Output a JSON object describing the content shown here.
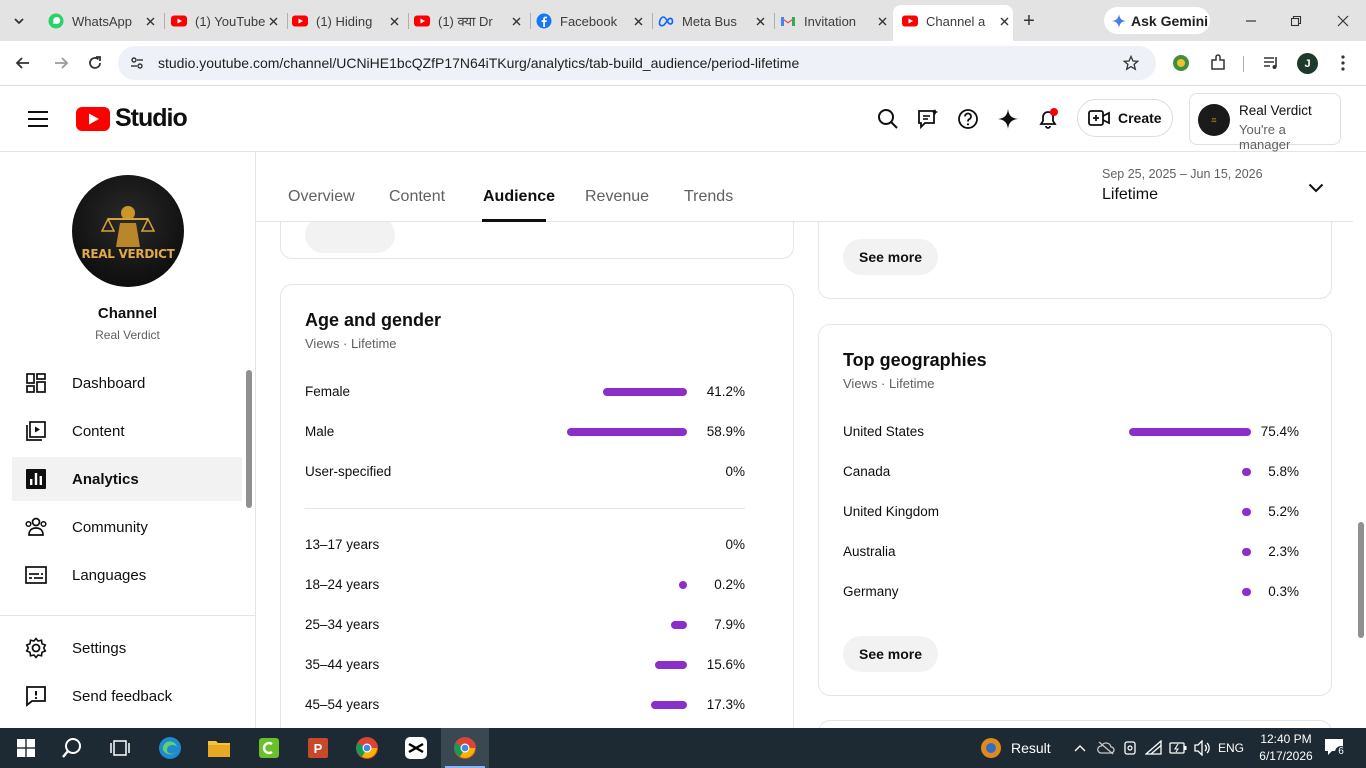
{
  "browser": {
    "tabs": [
      {
        "title": "WhatsApp",
        "favicon": "whatsapp-icon"
      },
      {
        "title": "(1) YouTube",
        "favicon": "youtube-icon"
      },
      {
        "title": "(1) Hiding",
        "favicon": "youtube-icon"
      },
      {
        "title": "(1) क्या Dr",
        "favicon": "youtube-icon"
      },
      {
        "title": "Facebook",
        "favicon": "facebook-icon"
      },
      {
        "title": "Meta Bus",
        "favicon": "meta-icon"
      },
      {
        "title": "Invitation",
        "favicon": "gmail-icon"
      },
      {
        "title": "Channel a",
        "favicon": "youtube-icon",
        "active": true
      }
    ],
    "ask_gemini": "Ask Gemini",
    "url": "studio.youtube.com/channel/UCNiHE1bcQZfP17N64iTKurg/analytics/tab-build_audience/period-lifetime",
    "profile_initial": "J"
  },
  "studio": {
    "logo_text": "Studio",
    "create_label": "Create",
    "account_name": "Real Verdict",
    "account_role": "You're a manager"
  },
  "sidebar": {
    "channel_label": "Channel",
    "channel_name": "Real Verdict",
    "avatar_text": "REAL VERDICT",
    "items": [
      {
        "label": "Dashboard",
        "icon": "dashboard-icon"
      },
      {
        "label": "Content",
        "icon": "content-icon"
      },
      {
        "label": "Analytics",
        "icon": "analytics-icon",
        "active": true
      },
      {
        "label": "Community",
        "icon": "community-icon"
      },
      {
        "label": "Languages",
        "icon": "languages-icon"
      }
    ],
    "settings": "Settings",
    "feedback": "Send feedback"
  },
  "analytics": {
    "tabs": [
      "Overview",
      "Content",
      "Audience",
      "Revenue",
      "Trends"
    ],
    "active_tab": "Audience",
    "date_range": "Sep 25, 2025 – Jun 15, 2026",
    "period": "Lifetime"
  },
  "age_gender": {
    "title": "Age and gender",
    "subtitle": "Views · Lifetime",
    "gender": [
      {
        "label": "Female",
        "value": "41.2%",
        "pct": 41.2
      },
      {
        "label": "Male",
        "value": "58.9%",
        "pct": 58.9
      },
      {
        "label": "User-specified",
        "value": "0%",
        "pct": 0
      }
    ],
    "ages": [
      {
        "label": "13–17 years",
        "value": "0%",
        "pct": 0
      },
      {
        "label": "18–24 years",
        "value": "0.2%",
        "pct": 0.2
      },
      {
        "label": "25–34 years",
        "value": "7.9%",
        "pct": 7.9
      },
      {
        "label": "35–44 years",
        "value": "15.6%",
        "pct": 15.6
      },
      {
        "label": "45–54 years",
        "value": "17.3%",
        "pct": 17.3
      }
    ]
  },
  "geographies": {
    "title": "Top geographies",
    "subtitle": "Views · Lifetime",
    "rows": [
      {
        "label": "United States",
        "value": "75.4%",
        "pct": 75.4
      },
      {
        "label": "Canada",
        "value": "5.8%",
        "pct": 5.8
      },
      {
        "label": "United Kingdom",
        "value": "5.2%",
        "pct": 5.2
      },
      {
        "label": "Australia",
        "value": "2.3%",
        "pct": 2.3
      },
      {
        "label": "Germany",
        "value": "0.3%",
        "pct": 0.3
      }
    ],
    "see_more": "See more"
  },
  "top_card": {
    "see_more": "See more"
  },
  "colors": {
    "bar": "#8b2fc9",
    "youtube_red": "#ff0000"
  },
  "taskbar": {
    "result_label": "Result",
    "lang": "ENG",
    "time": "12:40 PM",
    "date": "6/17/2026",
    "notif_count": "6"
  }
}
